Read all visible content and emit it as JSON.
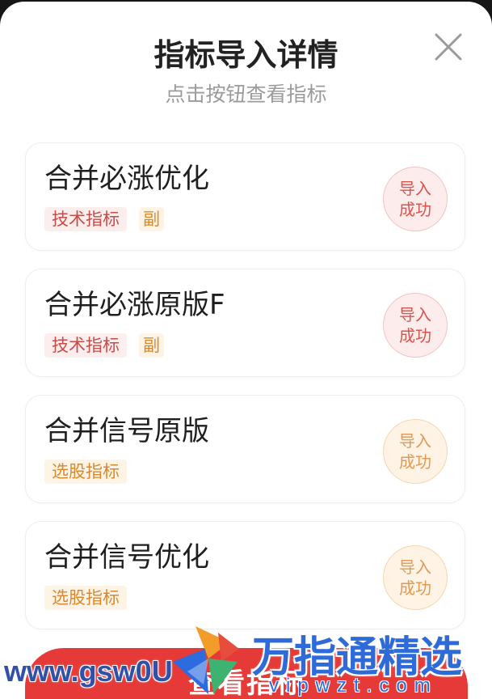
{
  "header": {
    "title": "指标导入详情",
    "subtitle": "点击按钮查看指标",
    "close_icon": "close-icon"
  },
  "indicators": [
    {
      "name": "合并必涨优化",
      "tags": [
        "技术指标",
        "副"
      ],
      "status_lines": [
        "导入",
        "成功"
      ],
      "status_color": "#d9534f"
    },
    {
      "name": "合并必涨原版F",
      "tags": [
        "技术指标",
        "副"
      ],
      "status_lines": [
        "导入",
        "成功"
      ],
      "status_color": "#d9534f"
    },
    {
      "name": "合并信号原版",
      "tags": [
        "选股指标"
      ],
      "status_lines": [
        "导入",
        "成功"
      ],
      "status_color": "#e09a55"
    },
    {
      "name": "合并信号优化",
      "tags": [
        "选股指标"
      ],
      "status_lines": [
        "导入",
        "成功"
      ],
      "status_color": "#e09a55"
    }
  ],
  "footer": {
    "button_label": "查看指标"
  },
  "watermark": {
    "site_text": "www.gsw0U",
    "brand_text": "万指通精选",
    "domain_text": "vipwzt.com",
    "logo_icon": "brand-logo-icon"
  },
  "colors": {
    "primary_button": "#e53a37",
    "title_text": "#222222",
    "subtitle_text": "#9b9b9b",
    "card_border": "#eeeeee",
    "tech_tag_bg": "#fdeeee",
    "tech_tag_text": "#c84b48",
    "sub_tag_bg": "#fef4e6",
    "sub_tag_text": "#d8892f",
    "stamp_red_bg": "#fdecec",
    "stamp_red_border": "#f2c3c3",
    "stamp_red_text": "#d9534f",
    "stamp_orange_bg": "#fef3e5",
    "stamp_orange_border": "#f6d6ae",
    "stamp_orange_text": "#e09a55",
    "watermark_blue": "#2e6bd9",
    "watermark_dark_blue": "#3150a8"
  }
}
